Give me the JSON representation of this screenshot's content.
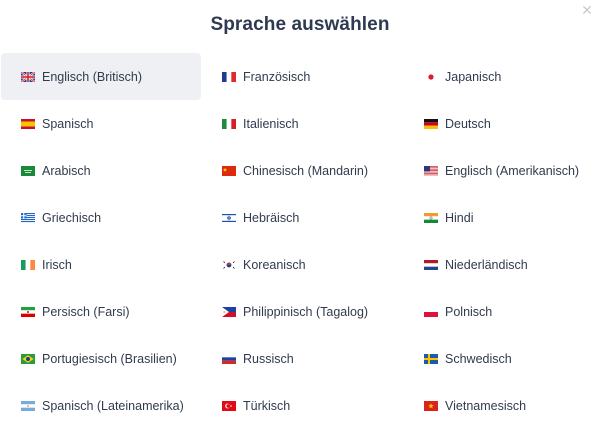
{
  "dialog": {
    "title": "Sprache auswählen",
    "close_glyph": "✕",
    "selected_index": 0
  },
  "languages": [
    {
      "label": "Englisch (Britisch)",
      "flag": "gb"
    },
    {
      "label": "Französisch",
      "flag": "fr"
    },
    {
      "label": "Japanisch",
      "flag": "jp"
    },
    {
      "label": "Spanisch",
      "flag": "es"
    },
    {
      "label": "Italienisch",
      "flag": "it"
    },
    {
      "label": "Deutsch",
      "flag": "de"
    },
    {
      "label": "Arabisch",
      "flag": "sa"
    },
    {
      "label": "Chinesisch (Mandarin)",
      "flag": "cn"
    },
    {
      "label": "Englisch (Amerikanisch)",
      "flag": "us"
    },
    {
      "label": "Griechisch",
      "flag": "gr"
    },
    {
      "label": "Hebräisch",
      "flag": "il"
    },
    {
      "label": "Hindi",
      "flag": "in"
    },
    {
      "label": "Irisch",
      "flag": "ie"
    },
    {
      "label": "Koreanisch",
      "flag": "kr"
    },
    {
      "label": "Niederländisch",
      "flag": "nl"
    },
    {
      "label": "Persisch (Farsi)",
      "flag": "ir"
    },
    {
      "label": "Philippinisch (Tagalog)",
      "flag": "ph"
    },
    {
      "label": "Polnisch",
      "flag": "pl"
    },
    {
      "label": "Portugiesisch (Brasilien)",
      "flag": "br"
    },
    {
      "label": "Russisch",
      "flag": "ru"
    },
    {
      "label": "Schwedisch",
      "flag": "se"
    },
    {
      "label": "Spanisch (Lateinamerika)",
      "flag": "ar"
    },
    {
      "label": "Türkisch",
      "flag": "tr"
    },
    {
      "label": "Vietnamesisch",
      "flag": "vn"
    }
  ]
}
